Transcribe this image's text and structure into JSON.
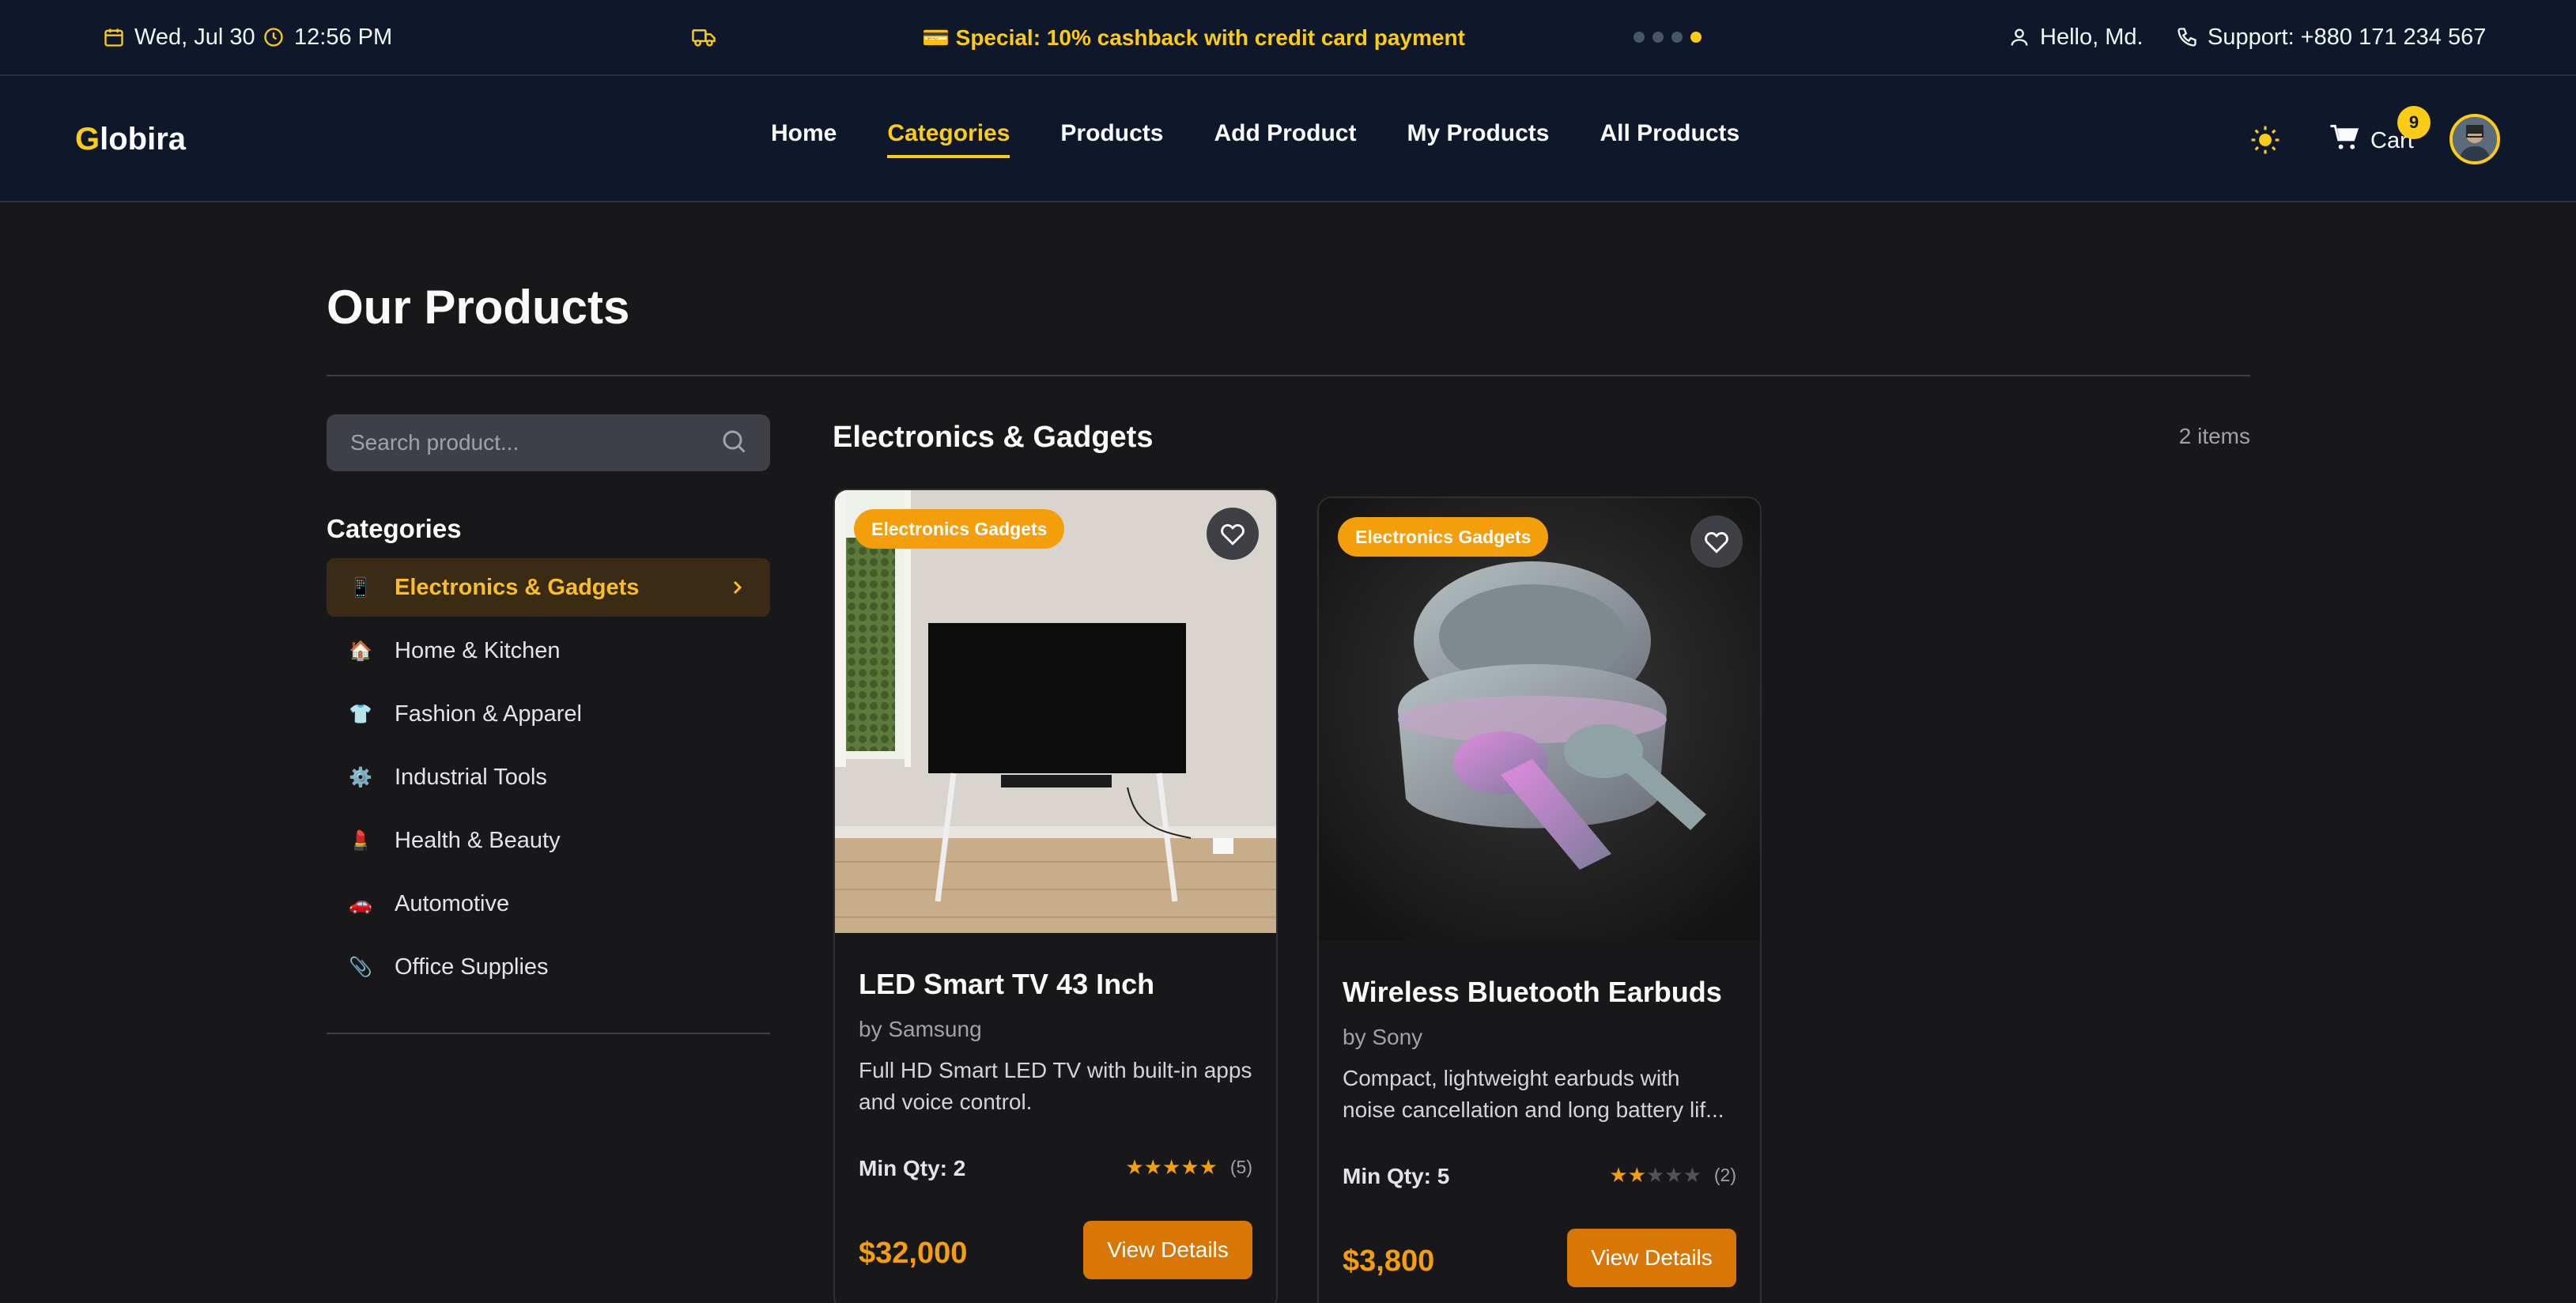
{
  "topbar": {
    "date": "Wed, Jul 30",
    "time": "12:56 PM",
    "promo": "💳 Special: 10% cashback with credit card payment",
    "greeting": "Hello, Md.",
    "support": "Support: +880 171 234 567",
    "slides_total": 4,
    "active_slide": 4
  },
  "nav": {
    "logo_first": "G",
    "logo_rest": "lobira",
    "links": [
      "Home",
      "Categories",
      "Products",
      "Add Product",
      "My Products",
      "All Products"
    ],
    "active": "Categories",
    "cart_label": "Cart",
    "cart_count": "9"
  },
  "page": {
    "title": "Our Products",
    "search_placeholder": "Search product...",
    "categories_heading": "Categories",
    "categories": [
      {
        "icon": "📱",
        "label": "Electronics & Gadgets",
        "active": true
      },
      {
        "icon": "🏠",
        "label": "Home & Kitchen",
        "active": false
      },
      {
        "icon": "👕",
        "label": "Fashion & Apparel",
        "active": false
      },
      {
        "icon": "⚙️",
        "label": "Industrial Tools",
        "active": false
      },
      {
        "icon": "💄",
        "label": "Health & Beauty",
        "active": false
      },
      {
        "icon": "🚗",
        "label": "Automotive",
        "active": false
      },
      {
        "icon": "📎",
        "label": "Office Supplies",
        "active": false
      }
    ],
    "section_title": "Electronics & Gadgets",
    "item_count": "2 items"
  },
  "products": [
    {
      "badge": "Electronics Gadgets",
      "name": "LED Smart TV 43 Inch",
      "brand": "by Samsung",
      "description": "Full HD Smart LED TV with built-in apps and voice control.",
      "min_qty": "Min Qty: 2",
      "rating": 5,
      "reviews": "(5)",
      "price": "$32,000",
      "button": "View Details"
    },
    {
      "badge": "Electronics Gadgets",
      "name": "Wireless Bluetooth Earbuds",
      "brand": "by Sony",
      "description": "Compact, lightweight earbuds with noise cancellation and long battery lif...",
      "min_qty": "Min Qty: 5",
      "rating": 2,
      "reviews": "(2)",
      "price": "$3,800",
      "button": "View Details"
    }
  ],
  "colors": {
    "accent": "#facc15",
    "price": "#f59e0b",
    "button": "#d97706",
    "background": "#18181b",
    "header": "#0f172a"
  }
}
